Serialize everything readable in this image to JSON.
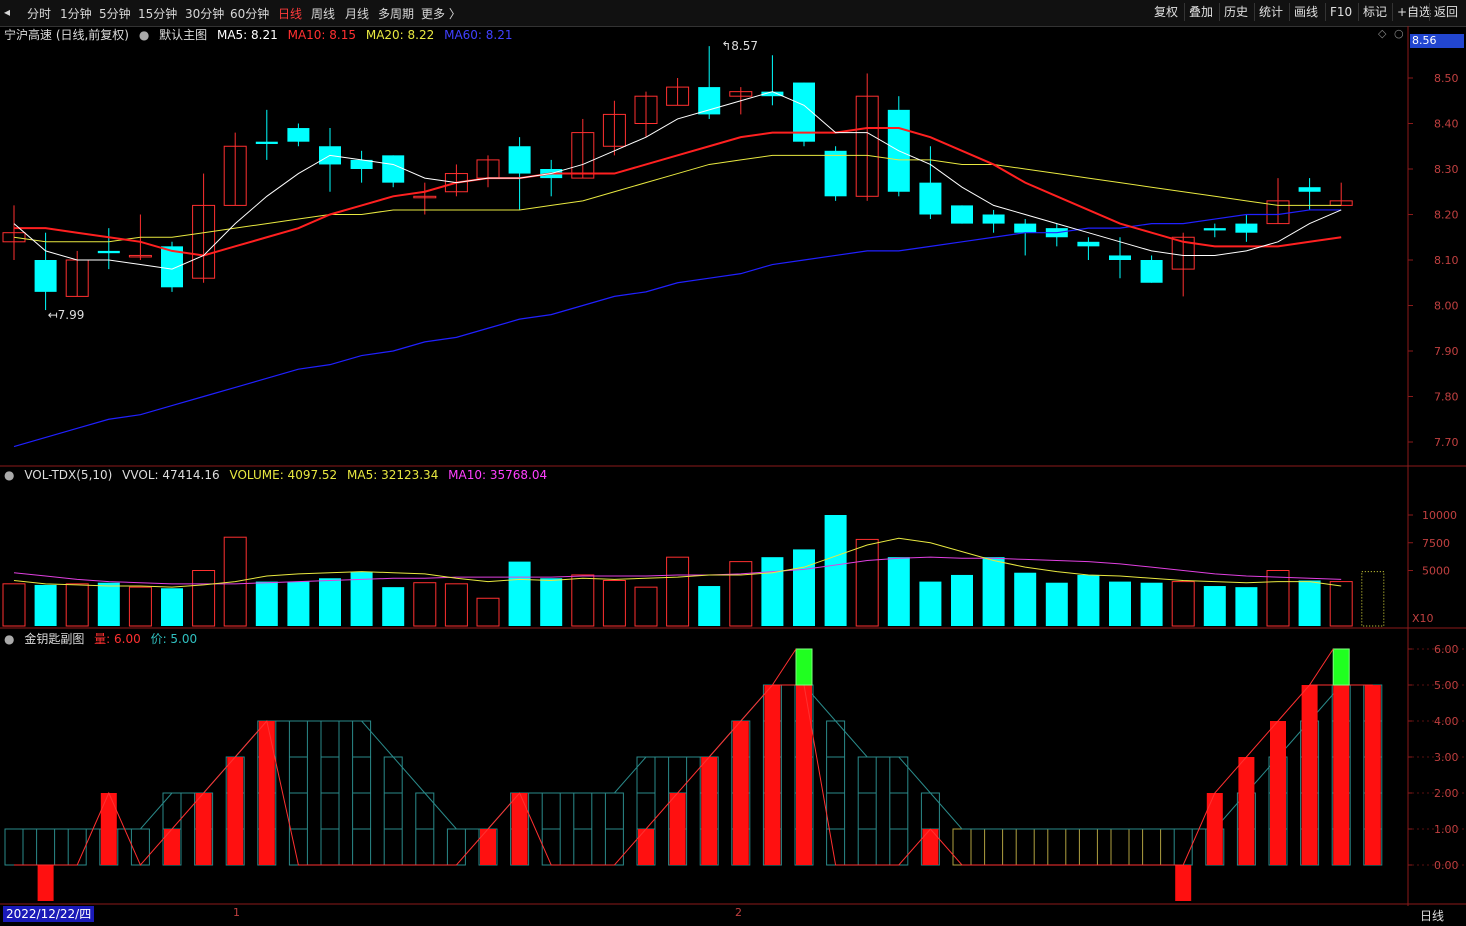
{
  "toolbar": {
    "periods": [
      "分时",
      "1分钟",
      "5分钟",
      "15分钟",
      "30分钟",
      "60分钟",
      "日线",
      "周线",
      "月线",
      "多周期",
      "更多 〉"
    ],
    "active_period": "日线",
    "tools": [
      "复权",
      "叠加",
      "历史",
      "统计",
      "画线",
      "F10",
      "标记",
      "+自选",
      "返回"
    ]
  },
  "main_header": {
    "stock": "宁沪高速 (日线,前复权)",
    "indicator": "默认主图",
    "ma5": "MA5: 8.21",
    "ma10": "MA10: 8.15",
    "ma20": "MA20: 8.22",
    "ma60": "MA60: 8.21"
  },
  "price_tag": "8.56",
  "price_axis": [
    "8.50",
    "8.40",
    "8.30",
    "8.20",
    "8.10",
    "8.00",
    "7.90",
    "7.80",
    "7.70"
  ],
  "annotations": {
    "high": "8.57",
    "low": "7.99"
  },
  "vol_header": {
    "name": "VOL-TDX(5,10)",
    "vvol": "VVOL: 47414.16",
    "volume": "VOLUME: 4097.52",
    "ma5": "MA5: 32123.34",
    "ma10": "MA10: 35768.04"
  },
  "vol_axis": [
    "10000",
    "7500",
    "5000"
  ],
  "vol_unit": "X10",
  "key_header": {
    "name": "金钥匙副图",
    "liang": "量: 6.00",
    "jia": "价: 5.00"
  },
  "key_axis": [
    "6.00",
    "5.00",
    "4.00",
    "3.00",
    "2.00",
    "1.00",
    "0.00"
  ],
  "date_label": "2022/12/22/四",
  "months": [
    "1",
    "2"
  ],
  "bottom_period": "日线",
  "colors": {
    "up": "#ff3030",
    "down": "#00ffff",
    "ma5": "#ffffff",
    "ma10": "#ff2020",
    "ma20": "#e8e840",
    "ma60": "#2020ff"
  },
  "chart_data": {
    "type": "candlestick",
    "candles": [
      {
        "o": 8.14,
        "c": 8.16,
        "h": 8.22,
        "l": 8.1
      },
      {
        "o": 8.1,
        "c": 8.03,
        "h": 8.16,
        "l": 7.99
      },
      {
        "o": 8.02,
        "c": 8.1,
        "h": 8.12,
        "l": 8.02
      },
      {
        "o": 8.12,
        "c": 8.115,
        "h": 8.17,
        "l": 8.08
      },
      {
        "o": 8.11,
        "c": 8.11,
        "h": 8.2,
        "l": 8.1
      },
      {
        "o": 8.13,
        "c": 8.04,
        "h": 8.14,
        "l": 8.03
      },
      {
        "o": 8.06,
        "c": 8.22,
        "h": 8.29,
        "l": 8.05
      },
      {
        "o": 8.22,
        "c": 8.35,
        "h": 8.38,
        "l": 8.22
      },
      {
        "o": 8.36,
        "c": 8.355,
        "h": 8.43,
        "l": 8.32
      },
      {
        "o": 8.39,
        "c": 8.36,
        "h": 8.4,
        "l": 8.35
      },
      {
        "o": 8.35,
        "c": 8.31,
        "h": 8.39,
        "l": 8.25
      },
      {
        "o": 8.32,
        "c": 8.3,
        "h": 8.34,
        "l": 8.27
      },
      {
        "o": 8.33,
        "c": 8.27,
        "h": 8.33,
        "l": 8.26
      },
      {
        "o": 8.24,
        "c": 8.24,
        "h": 8.27,
        "l": 8.2
      },
      {
        "o": 8.25,
        "c": 8.29,
        "h": 8.31,
        "l": 8.24
      },
      {
        "o": 8.28,
        "c": 8.32,
        "h": 8.33,
        "l": 8.26
      },
      {
        "o": 8.35,
        "c": 8.29,
        "h": 8.37,
        "l": 8.21
      },
      {
        "o": 8.3,
        "c": 8.28,
        "h": 8.32,
        "l": 8.24
      },
      {
        "o": 8.28,
        "c": 8.38,
        "h": 8.41,
        "l": 8.28
      },
      {
        "o": 8.35,
        "c": 8.42,
        "h": 8.45,
        "l": 8.33
      },
      {
        "o": 8.4,
        "c": 8.46,
        "h": 8.47,
        "l": 8.37
      },
      {
        "o": 8.44,
        "c": 8.48,
        "h": 8.5,
        "l": 8.44
      },
      {
        "o": 8.48,
        "c": 8.42,
        "h": 8.57,
        "l": 8.41
      },
      {
        "o": 8.46,
        "c": 8.47,
        "h": 8.48,
        "l": 8.42
      },
      {
        "o": 8.47,
        "c": 8.46,
        "h": 8.55,
        "l": 8.44
      },
      {
        "o": 8.49,
        "c": 8.36,
        "h": 8.49,
        "l": 8.35
      },
      {
        "o": 8.34,
        "c": 8.24,
        "h": 8.35,
        "l": 8.23
      },
      {
        "o": 8.24,
        "c": 8.46,
        "h": 8.51,
        "l": 8.23
      },
      {
        "o": 8.43,
        "c": 8.25,
        "h": 8.46,
        "l": 8.24
      },
      {
        "o": 8.27,
        "c": 8.2,
        "h": 8.35,
        "l": 8.19
      },
      {
        "o": 8.22,
        "c": 8.18,
        "h": 8.22,
        "l": 8.18
      },
      {
        "o": 8.2,
        "c": 8.18,
        "h": 8.21,
        "l": 8.16
      },
      {
        "o": 8.18,
        "c": 8.16,
        "h": 8.19,
        "l": 8.11
      },
      {
        "o": 8.17,
        "c": 8.15,
        "h": 8.18,
        "l": 8.13
      },
      {
        "o": 8.14,
        "c": 8.13,
        "h": 8.15,
        "l": 8.1
      },
      {
        "o": 8.11,
        "c": 8.1,
        "h": 8.15,
        "l": 8.06
      },
      {
        "o": 8.1,
        "c": 8.05,
        "h": 8.11,
        "l": 8.05
      },
      {
        "o": 8.08,
        "c": 8.15,
        "h": 8.16,
        "l": 8.02
      },
      {
        "o": 8.17,
        "c": 8.165,
        "h": 8.18,
        "l": 8.15
      },
      {
        "o": 8.18,
        "c": 8.16,
        "h": 8.2,
        "l": 8.14
      },
      {
        "o": 8.18,
        "c": 8.23,
        "h": 8.28,
        "l": 8.18
      },
      {
        "o": 8.26,
        "c": 8.25,
        "h": 8.28,
        "l": 8.21
      },
      {
        "o": 8.22,
        "c": 8.23,
        "h": 8.27,
        "l": 8.22
      }
    ],
    "ma5": [
      8.18,
      8.12,
      8.1,
      8.1,
      8.09,
      8.08,
      8.11,
      8.18,
      8.24,
      8.29,
      8.33,
      8.32,
      8.31,
      8.28,
      8.27,
      8.28,
      8.28,
      8.29,
      8.31,
      8.34,
      8.37,
      8.41,
      8.43,
      8.45,
      8.47,
      8.44,
      8.38,
      8.38,
      8.34,
      8.31,
      8.26,
      8.22,
      8.2,
      8.18,
      8.16,
      8.14,
      8.12,
      8.11,
      8.11,
      8.12,
      8.14,
      8.18,
      8.21
    ],
    "ma10": [
      8.17,
      8.17,
      8.16,
      8.15,
      8.14,
      8.12,
      8.11,
      8.13,
      8.15,
      8.17,
      8.2,
      8.22,
      8.24,
      8.25,
      8.27,
      8.28,
      8.28,
      8.29,
      8.29,
      8.29,
      8.31,
      8.33,
      8.35,
      8.37,
      8.38,
      8.38,
      8.38,
      8.39,
      8.39,
      8.37,
      8.34,
      8.31,
      8.27,
      8.24,
      8.21,
      8.18,
      8.16,
      8.14,
      8.13,
      8.13,
      8.13,
      8.14,
      8.15
    ],
    "ma20": [
      8.15,
      8.14,
      8.14,
      8.14,
      8.15,
      8.15,
      8.16,
      8.17,
      8.18,
      8.19,
      8.2,
      8.2,
      8.21,
      8.21,
      8.21,
      8.21,
      8.21,
      8.22,
      8.23,
      8.25,
      8.27,
      8.29,
      8.31,
      8.32,
      8.33,
      8.33,
      8.33,
      8.33,
      8.32,
      8.32,
      8.31,
      8.31,
      8.3,
      8.29,
      8.28,
      8.27,
      8.26,
      8.25,
      8.24,
      8.23,
      8.22,
      8.22,
      8.22
    ],
    "ma60": [
      7.69,
      7.71,
      7.73,
      7.75,
      7.76,
      7.78,
      7.8,
      7.82,
      7.84,
      7.86,
      7.87,
      7.89,
      7.9,
      7.92,
      7.93,
      7.95,
      7.97,
      7.98,
      8.0,
      8.02,
      8.03,
      8.05,
      8.06,
      8.07,
      8.09,
      8.1,
      8.11,
      8.12,
      8.12,
      8.13,
      8.14,
      8.15,
      8.16,
      8.16,
      8.17,
      8.17,
      8.18,
      8.18,
      8.19,
      8.2,
      8.2,
      8.21,
      8.21
    ],
    "volume": [
      3800,
      3700,
      3800,
      3900,
      3500,
      3400,
      5000,
      8000,
      4000,
      4000,
      4300,
      4900,
      3500,
      3900,
      3800,
      2500,
      5800,
      4300,
      4600,
      4100,
      3500,
      6200,
      3600,
      5800,
      6200,
      6900,
      10000,
      7800,
      6200,
      4000,
      4600,
      6200,
      4800,
      3900,
      4600,
      4000,
      3900,
      4000,
      3600,
      3500,
      5000,
      4100,
      4000
    ],
    "vol_ma5": [
      4100,
      3800,
      3700,
      3600,
      3600,
      3500,
      3700,
      4000,
      4500,
      4700,
      4800,
      4900,
      4800,
      4700,
      4300,
      4000,
      4200,
      4100,
      4300,
      4200,
      4300,
      4400,
      4600,
      4600,
      4800,
      5300,
      6300,
      7300,
      7900,
      7500,
      6700,
      5900,
      5300,
      4900,
      4600,
      4500,
      4300,
      4100,
      4000,
      3900,
      4000,
      4000,
      3600
    ],
    "vol_ma10": [
      4800,
      4500,
      4200,
      4000,
      3900,
      3800,
      3800,
      3800,
      3900,
      4000,
      4100,
      4200,
      4300,
      4300,
      4400,
      4400,
      4400,
      4400,
      4500,
      4500,
      4500,
      4600,
      4600,
      4700,
      4900,
      5100,
      5500,
      5900,
      6100,
      6200,
      6100,
      6100,
      6000,
      5900,
      5800,
      5600,
      5300,
      5000,
      4700,
      4500,
      4400,
      4300,
      4200
    ],
    "key_price": [
      1,
      1,
      1,
      1,
      1,
      2,
      2,
      3,
      4,
      4,
      4,
      4,
      3,
      2,
      1,
      1,
      2,
      2,
      2,
      2,
      3,
      3,
      3,
      4,
      5,
      5,
      4,
      3,
      3,
      2,
      1,
      1,
      1,
      1,
      1,
      1,
      1,
      1,
      1,
      2,
      3,
      4,
      5,
      5
    ],
    "key_vol": [
      0,
      -1,
      0,
      2,
      0,
      1,
      2,
      3,
      4,
      0,
      0,
      0,
      0,
      0,
      0,
      1,
      2,
      0,
      0,
      0,
      1,
      2,
      3,
      4,
      5,
      5,
      0,
      0,
      0,
      1,
      0,
      0,
      0,
      0,
      0,
      0,
      0,
      -1,
      2,
      3,
      4,
      5,
      5,
      5
    ],
    "key_signal": [
      0,
      0,
      0,
      0,
      0,
      0,
      0,
      0,
      0,
      0,
      0,
      0,
      0,
      0,
      0,
      0,
      0,
      0,
      0,
      0,
      0,
      0,
      0,
      0,
      0,
      6,
      0,
      0,
      0,
      0,
      0,
      0,
      0,
      0,
      0,
      0,
      0,
      0,
      0,
      0,
      0,
      0,
      6
    ]
  }
}
